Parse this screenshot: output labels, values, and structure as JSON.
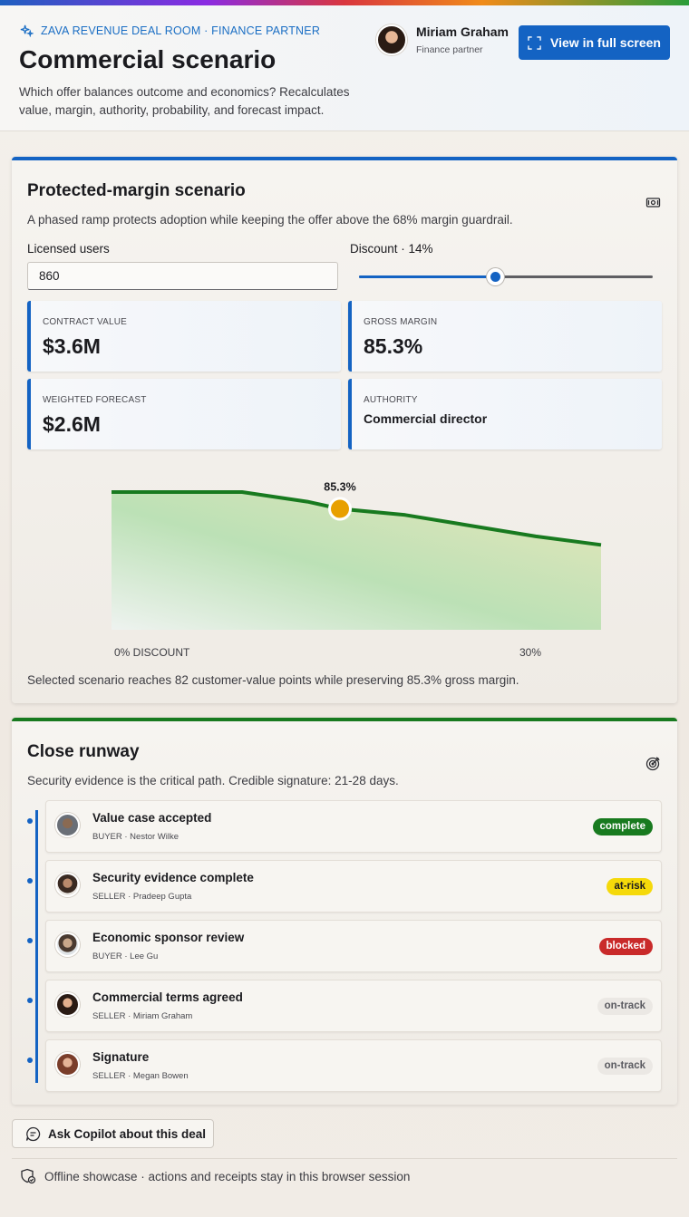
{
  "header": {
    "kicker": "ZAVA REVENUE DEAL ROOM · FINANCE PARTNER",
    "title": "Commercial scenario",
    "subtitle": "Which offer balances outcome and economics? Recalculates value, margin, authority, probability, and forecast impact.",
    "user_name": "Miriam Graham",
    "user_role": "Finance partner",
    "fullscreen_label": "View in full screen"
  },
  "scenario": {
    "title": "Protected-margin scenario",
    "description": "A phased ramp protects adoption while keeping the offer above the 68% margin guardrail.",
    "users_label": "Licensed users",
    "users_value": "860",
    "discount_label": "Discount · 14%",
    "discount_percent": 14,
    "discount_max": 30,
    "metrics": [
      {
        "label": "CONTRACT VALUE",
        "value": "$3.6M"
      },
      {
        "label": "GROSS MARGIN",
        "value": "85.3%"
      },
      {
        "label": "WEIGHTED FORECAST",
        "value": "$2.6M"
      },
      {
        "label": "AUTHORITY",
        "value": "Commercial director"
      }
    ],
    "chart_marker_label": "85.3%",
    "chart_tick_left": "0% DISCOUNT",
    "chart_tick_right": "30%",
    "footnote": "Selected scenario reaches 82 customer-value points while preserving 85.3% gross margin."
  },
  "chart_data": {
    "type": "area",
    "x": [
      0,
      4,
      8,
      12,
      14,
      18,
      22,
      26,
      30
    ],
    "y": [
      91.6,
      91.6,
      91.6,
      88.0,
      85.3,
      83.0,
      79.0,
      75.0,
      71.8
    ],
    "selected": {
      "x": 14,
      "y": 85.3
    },
    "xlabel": "",
    "ylabel": "",
    "color_line": "#187a1f",
    "color_marker": "#e8a000"
  },
  "runway": {
    "title": "Close runway",
    "description": "Security evidence is the critical path. Credible signature: 21-28 days.",
    "items": [
      {
        "title": "Value case accepted",
        "sub": "BUYER · Nestor Wilke",
        "status": "complete"
      },
      {
        "title": "Security evidence complete",
        "sub": "SELLER · Pradeep Gupta",
        "status": "at-risk"
      },
      {
        "title": "Economic sponsor review",
        "sub": "BUYER · Lee Gu",
        "status": "blocked"
      },
      {
        "title": "Commercial terms agreed",
        "sub": "SELLER · Miriam Graham",
        "status": "on-track"
      },
      {
        "title": "Signature",
        "sub": "SELLER · Megan Bowen",
        "status": "on-track"
      }
    ]
  },
  "footer": {
    "copilot_label": "Ask Copilot about this deal",
    "offline_note": "Offline showcase · actions and receipts stay in this browser session"
  },
  "colors": {
    "accent": "#1463c3",
    "success": "#187a1f",
    "warning": "#f5d90a",
    "danger": "#c92a2a"
  }
}
